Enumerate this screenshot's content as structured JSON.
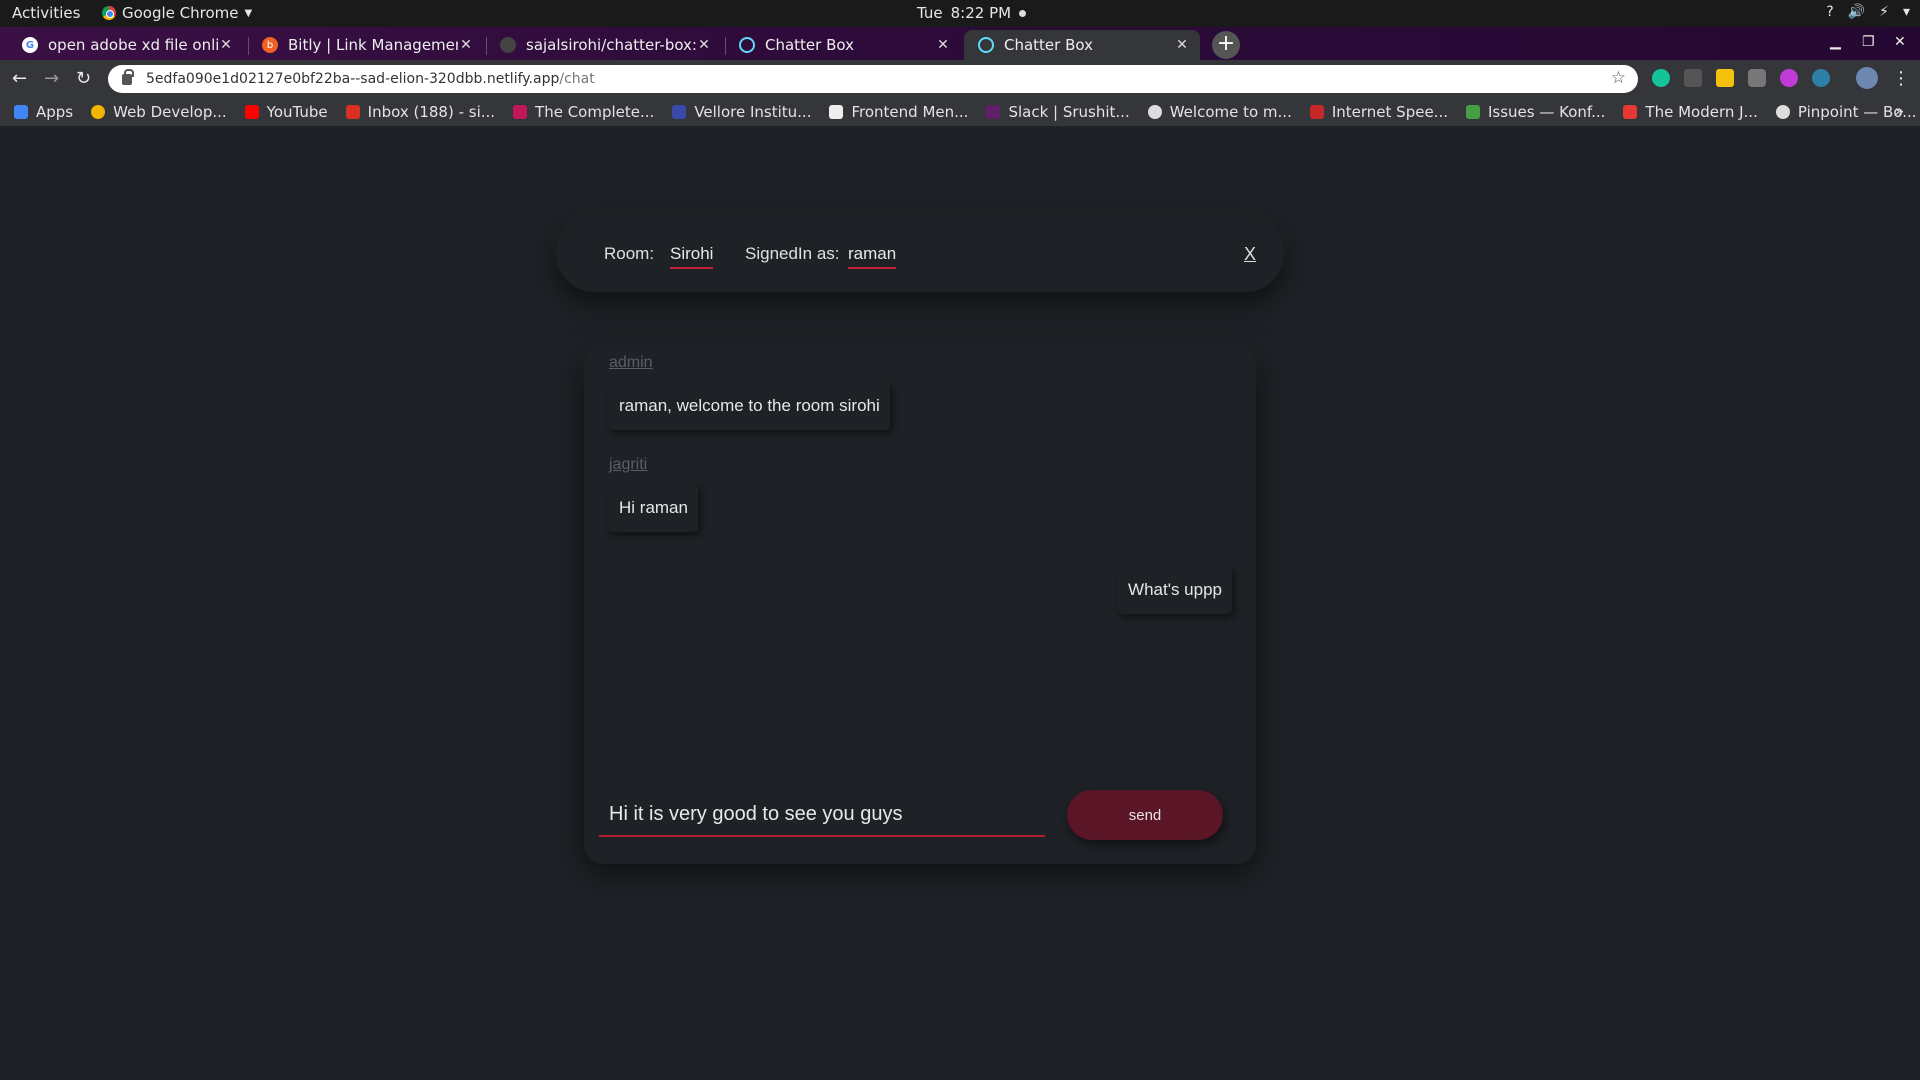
{
  "system": {
    "activities": "Activities",
    "app_name": "Google Chrome",
    "day": "Tue",
    "time": "8:22 PM",
    "tray": [
      "?",
      "🔊",
      "⚡",
      "▾"
    ]
  },
  "tabs": [
    {
      "title": "open adobe xd file online",
      "favicon": "google-icon",
      "color": "#ffffff"
    },
    {
      "title": "Bitly | Link Management",
      "favicon": "bitly-icon",
      "color": "#ee6123"
    },
    {
      "title": "sajalsirohi/chatter-box: M",
      "favicon": "github-icon",
      "color": "#333333"
    },
    {
      "title": "Chatter Box",
      "favicon": "react-icon",
      "color": "#61dafb"
    },
    {
      "title": "Chatter Box",
      "favicon": "react-icon",
      "color": "#61dafb"
    }
  ],
  "url": {
    "host": "5edfa090e1d02127e0bf22ba--sad-elion-320dbb.netlify.app",
    "path": "/chat"
  },
  "bookmarks": [
    {
      "label": "Apps",
      "color": "#4285f4"
    },
    {
      "label": "Web Develop...",
      "color": "#f4b400"
    },
    {
      "label": "YouTube",
      "color": "#ff0000"
    },
    {
      "label": "Inbox (188) - si...",
      "color": "#d93025"
    },
    {
      "label": "The Complete...",
      "color": "#c2185b"
    },
    {
      "label": "Vellore Institu...",
      "color": "#3949ab"
    },
    {
      "label": "Frontend Men...",
      "color": "#eeeeee"
    },
    {
      "label": "Slack | Srushit...",
      "color": "#611f69"
    },
    {
      "label": "Welcome to m...",
      "color": "#dddddd"
    },
    {
      "label": "Internet Spee...",
      "color": "#c62828"
    },
    {
      "label": "Issues — Konf...",
      "color": "#43a047"
    },
    {
      "label": "The Modern J...",
      "color": "#e53935"
    },
    {
      "label": "Pinpoint — Bo...",
      "color": "#dddddd"
    }
  ],
  "chat": {
    "room_label": "Room:",
    "room": "Sirohi",
    "signed_label": "SignedIn as:",
    "user": "raman",
    "close": "X",
    "messages": [
      {
        "author": "admin",
        "text": "raman, welcome to the room sirohi"
      },
      {
        "author": "jagriti",
        "text": "Hi raman"
      },
      {
        "author": "",
        "text": "What's uppp"
      }
    ],
    "input_value": "Hi it is very good to see you guys",
    "send": "send",
    "accent": "#c1223c",
    "button_color": "#5a1526"
  }
}
